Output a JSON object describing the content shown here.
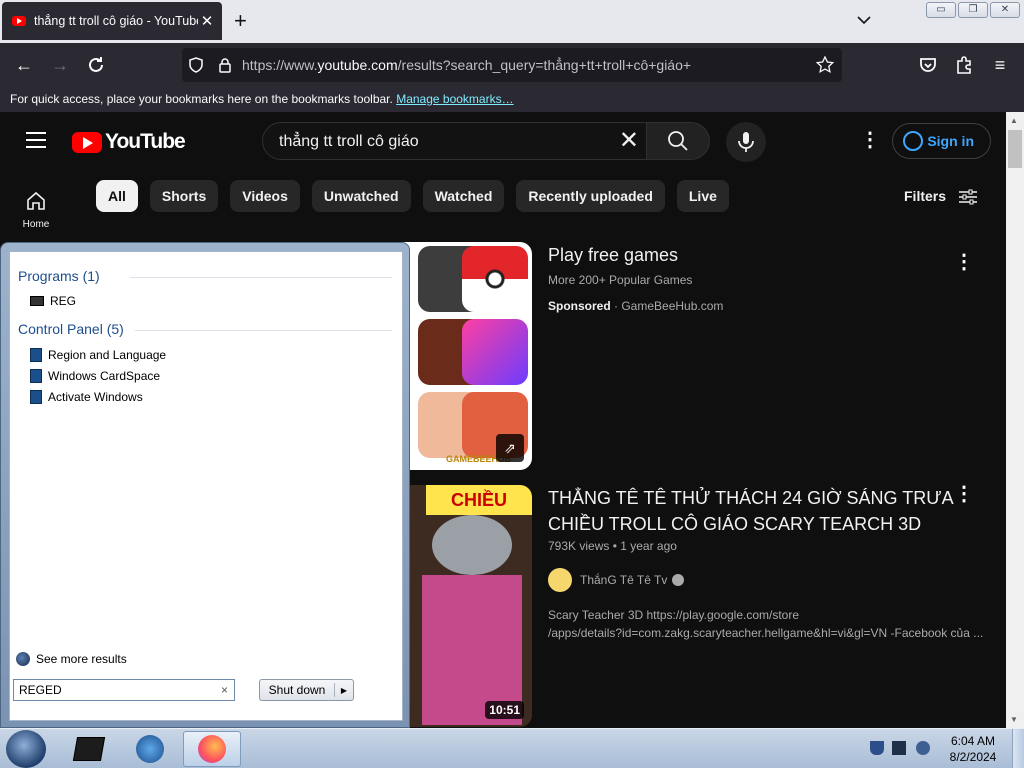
{
  "browser": {
    "tab_title": "thẳng tt troll cô giáo - YouTube",
    "tab_close": "✕",
    "new_tab": "+",
    "url_prefix": "https://www.",
    "url_domain": "youtube.com",
    "url_rest": "/results?search_query=thẳng+tt+troll+cô+giáo+",
    "bookmarks_text": "For quick access, place your bookmarks here on the bookmarks toolbar.",
    "bookmarks_link": "Manage bookmarks…"
  },
  "youtube": {
    "logo_text": "YouTube",
    "search_value": "thẳng tt troll cô giáo",
    "sign_in": "Sign in",
    "home_label": "Home",
    "chips": [
      "All",
      "Shorts",
      "Videos",
      "Unwatched",
      "Watched",
      "Recently uploaded",
      "Live"
    ],
    "filters_label": "Filters",
    "ad": {
      "title": "Play free games",
      "subtitle": "More 200+ Popular Games",
      "sponsored": "Sponsored",
      "advertiser": "GameBeeHub.com",
      "watermark": "GAMEBEEHUB"
    },
    "video": {
      "title_line1": "THẲNG TÊ TÊ THỬ THÁCH 24 GIỜ SÁNG TRƯA",
      "title_line2": "CHIỀU TROLL CÔ GIÁO SCARY TEARCH 3D",
      "views": "793K views",
      "age": "1 year ago",
      "channel": "ThắnG Tê Tê Tv",
      "desc_line1": "Scary Teacher 3D https://play.google.com/store",
      "desc_line2": "/apps/details?id=com.zakg.scaryteacher.hellgame&hl=vi&gl=VN -Facebook của ...",
      "duration": "10:51",
      "thumb_label": "CHIỀU"
    }
  },
  "startmenu": {
    "programs_header": "Programs (1)",
    "programs": [
      "REG"
    ],
    "control_header": "Control Panel (5)",
    "control_items": [
      "Region and Language",
      "Windows CardSpace",
      "Activate Windows"
    ],
    "see_more": "See more results",
    "search_value": "REGED",
    "shutdown_label": "Shut down"
  },
  "taskbar": {
    "time": "6:04 AM",
    "date": "8/2/2024"
  }
}
